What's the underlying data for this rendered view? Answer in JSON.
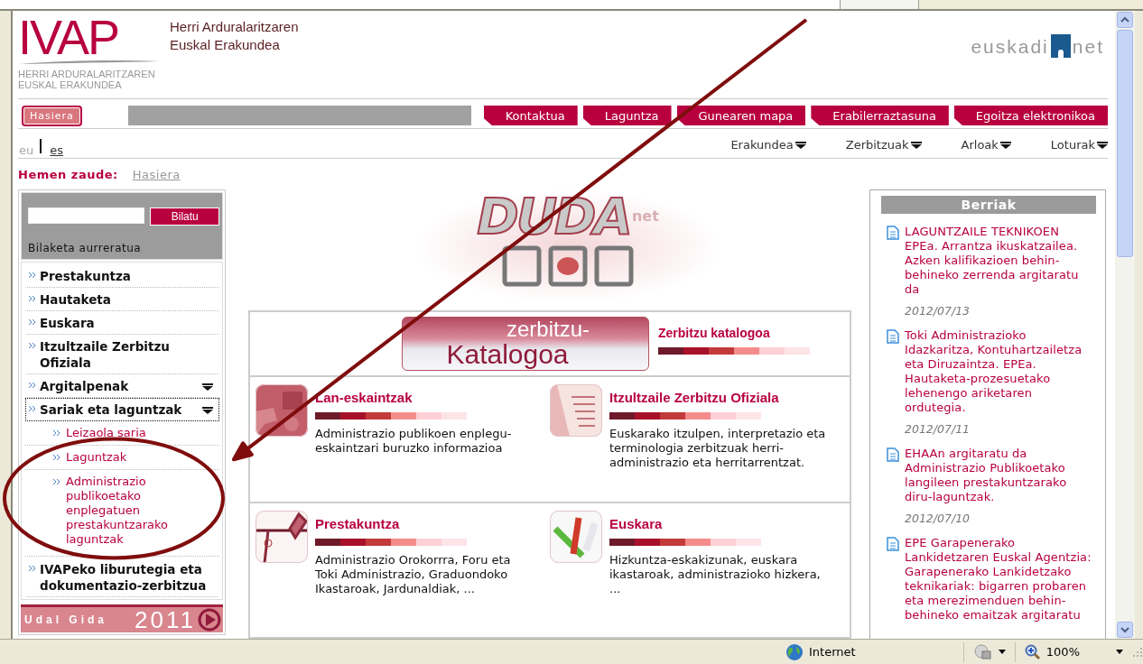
{
  "header": {
    "logo": "IVAP",
    "logo_subtitle": [
      "HERRI ARDURALARITZAREN",
      "EUSKAL ERAKUNDEA"
    ],
    "org_name": [
      "Herri Arduralaritzaren",
      "Euskal Erakundea"
    ],
    "partner_logo": [
      "euskadi",
      "net"
    ]
  },
  "nav": {
    "home": "Hasiera",
    "tabs": [
      "Kontaktua",
      "Laguntza",
      "Gunearen mapa",
      "Erabilerraztasuna",
      "Egoitza elektronikoa"
    ]
  },
  "languages": [
    {
      "label": "eu",
      "selected": true
    },
    {
      "label": "es",
      "selected": false
    }
  ],
  "menus": [
    "Erakundea",
    "Zerbitzuak",
    "Arloak",
    "Loturak"
  ],
  "breadcrumb": {
    "label": "Hemen zaude:",
    "items": [
      "Hasiera"
    ]
  },
  "search": {
    "button": "Bilatu",
    "advanced": "Bilaketa aurreratua"
  },
  "sidebar": {
    "items": [
      {
        "label": "Prestakuntza",
        "has_submenu": false,
        "focused": false
      },
      {
        "label": "Hautaketa",
        "has_submenu": false,
        "focused": false
      },
      {
        "label": "Euskara",
        "has_submenu": false,
        "focused": false
      },
      {
        "label": "Itzultzaile Zerbitzu Ofiziala",
        "has_submenu": false,
        "focused": false
      },
      {
        "label": "Argitalpenak",
        "has_submenu": true,
        "focused": false
      },
      {
        "label": "Sariak eta laguntzak",
        "has_submenu": true,
        "focused": true,
        "children": [
          {
            "label": "Leizaola saria"
          },
          {
            "label": "Laguntzak"
          },
          {
            "label": "Administrazio publikoetako enplegatuen prestakuntzarako laguntzak"
          }
        ]
      },
      {
        "label": "IVAPeko liburutegia eta dokumentazio-zerbitzua",
        "has_submenu": false,
        "focused": false
      }
    ],
    "banner": {
      "title": "Udal Gida",
      "year": "2011"
    }
  },
  "duda_logo": {
    "word": "DUDA",
    "suffix": "net"
  },
  "catalog": {
    "banner_top": "zerbitzu-",
    "banner_bottom": "Katalogoa",
    "link": "Zerbitzu katalogoa"
  },
  "services": [
    {
      "title": "Lan-eskaintzak",
      "description": "Administrazio publikoen enplegu-eskaintzari buruzko informazioa",
      "kind": "picture"
    },
    {
      "title": "Itzultzaile Zerbitzu Ofiziala",
      "description": "Euskarako itzulpen, interpretazio eta terminologia zerbitzuak herri-administrazio eta herritarrentzat.",
      "kind": "picture"
    },
    {
      "title": "Prestakuntza",
      "description": "Administrazio Orokorrra, Foru eta Toki Administrazio, Graduondoko Ikastaroak, Jardunaldiak, ...",
      "kind": "picture"
    },
    {
      "title": "Euskara",
      "description": "Hizkuntza-eskakizunak, euskara ikastaroak, administrazioko hizkera, ...",
      "kind": "picture"
    }
  ],
  "news": {
    "title": "Berriak",
    "items": [
      {
        "text": "LAGUNTZAILE TEKNIKOEN EPEa. Arrantza ikuskatzailea. Azken kalifikazioen behin-behineko zerrenda argitaratu da",
        "date": "2012/07/13"
      },
      {
        "text": "Toki Administrazioko Idazkaritza, Kontuhartzailetza eta Diruzaintza. EPEa. Hautaketa-prozesuetako lehenengo ariketaren ordutegia.",
        "date": "2012/07/11"
      },
      {
        "text": "EHAAn argitaratu da Administrazio Publikoetako langileen prestakuntzarako diru-laguntzak.",
        "date": "2012/07/10"
      },
      {
        "text": "EPE Garapenerako Lankidetzaren Euskal Agentzia: Garapenerako Lankidetzako teknikariak: bigarren probaren eta merezimenduen behin-behineko emaitzak argitaratu"
      }
    ]
  },
  "status_bar": {
    "zone": "Internet",
    "zoom": "100%"
  }
}
